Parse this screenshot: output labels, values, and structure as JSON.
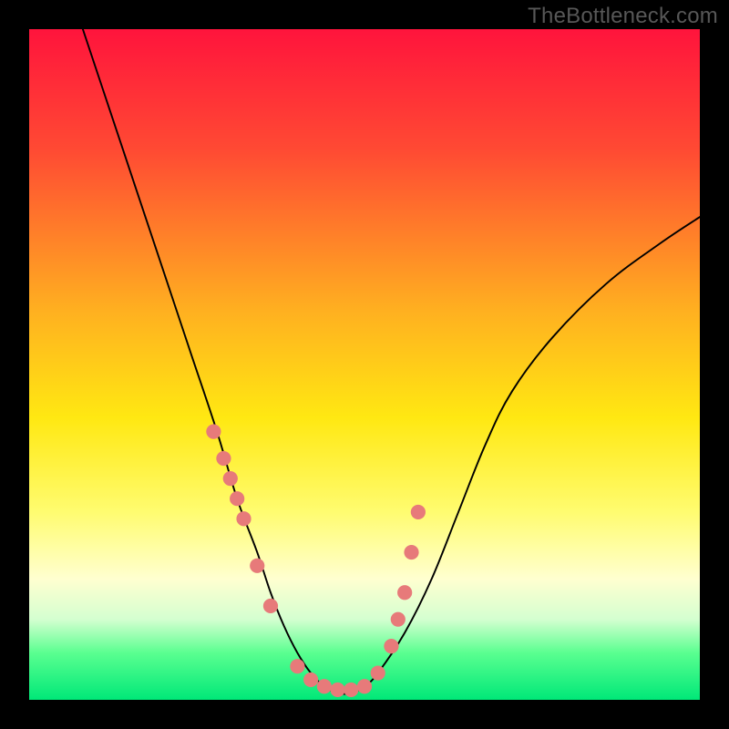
{
  "watermark": "TheBottleneck.com",
  "chart_data": {
    "type": "line",
    "title": "",
    "xlabel": "",
    "ylabel": "",
    "xlim": [
      0,
      100
    ],
    "ylim": [
      0,
      100
    ],
    "series": [
      {
        "name": "bottleneck-curve",
        "x": [
          8,
          12,
          16,
          20,
          24,
          28,
          31,
          34,
          36,
          38,
          40,
          42,
          44,
          46,
          48,
          50,
          52,
          56,
          60,
          64,
          68,
          72,
          78,
          86,
          94,
          100
        ],
        "y": [
          100,
          88,
          76,
          64,
          52,
          40,
          30,
          22,
          16,
          11,
          7,
          4,
          2,
          1,
          1,
          2,
          4,
          10,
          18,
          28,
          38,
          46,
          54,
          62,
          68,
          72
        ]
      }
    ],
    "markers": {
      "name": "highlight-points",
      "color": "#e77a7a",
      "x": [
        27.5,
        29,
        30,
        31,
        32,
        34,
        36,
        40,
        42,
        44,
        46,
        48,
        50,
        52,
        54,
        55,
        56,
        57,
        58
      ],
      "y": [
        40,
        36,
        33,
        30,
        27,
        20,
        14,
        5,
        3,
        2,
        1.5,
        1.5,
        2,
        4,
        8,
        12,
        16,
        22,
        28
      ]
    }
  }
}
